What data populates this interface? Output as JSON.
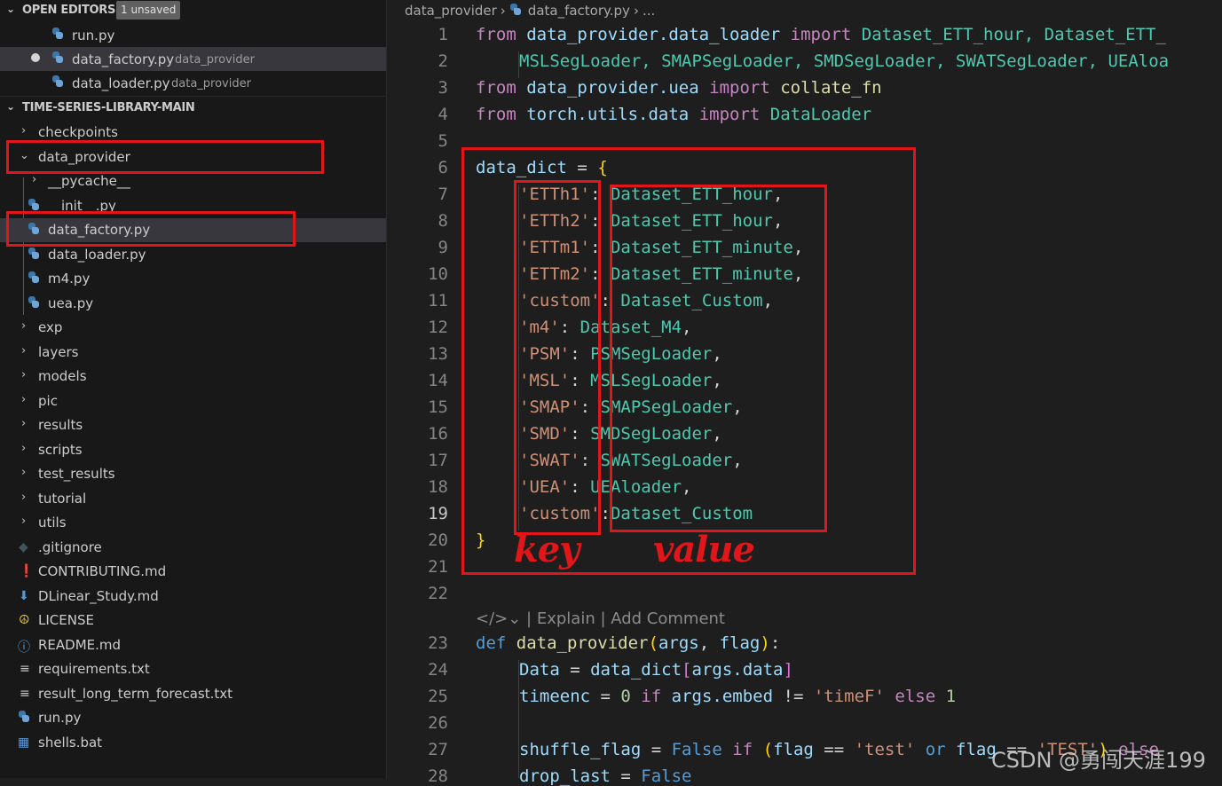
{
  "sidebar": {
    "open_editors": {
      "title": "OPEN EDITORS",
      "badge": "1 unsaved",
      "items": [
        {
          "name": "run.py",
          "path": ""
        },
        {
          "name": "data_factory.py",
          "path": "data_provider"
        },
        {
          "name": "data_loader.py",
          "path": "data_provider"
        }
      ]
    },
    "explorer": {
      "title": "TIME-SERIES-LIBRARY-MAIN",
      "items": [
        {
          "label": "checkpoints",
          "kind": "folder"
        },
        {
          "label": "data_provider",
          "kind": "folder-open"
        },
        {
          "label": "__pycache__",
          "kind": "folder"
        },
        {
          "label": "__init__.py",
          "kind": "py"
        },
        {
          "label": "data_factory.py",
          "kind": "py"
        },
        {
          "label": "data_loader.py",
          "kind": "py"
        },
        {
          "label": "m4.py",
          "kind": "py"
        },
        {
          "label": "uea.py",
          "kind": "py"
        },
        {
          "label": "exp",
          "kind": "folder"
        },
        {
          "label": "layers",
          "kind": "folder"
        },
        {
          "label": "models",
          "kind": "folder"
        },
        {
          "label": "pic",
          "kind": "folder"
        },
        {
          "label": "results",
          "kind": "folder"
        },
        {
          "label": "scripts",
          "kind": "folder"
        },
        {
          "label": "test_results",
          "kind": "folder"
        },
        {
          "label": "tutorial",
          "kind": "folder"
        },
        {
          "label": "utils",
          "kind": "folder"
        },
        {
          "label": ".gitignore",
          "kind": "git"
        },
        {
          "label": "CONTRIBUTING.md",
          "kind": "md-red"
        },
        {
          "label": "DLinear_Study.md",
          "kind": "md-blue"
        },
        {
          "label": "LICENSE",
          "kind": "license"
        },
        {
          "label": "README.md",
          "kind": "info"
        },
        {
          "label": "requirements.txt",
          "kind": "txt"
        },
        {
          "label": "result_long_term_forecast.txt",
          "kind": "txt"
        },
        {
          "label": "run.py",
          "kind": "py"
        },
        {
          "label": "shells.bat",
          "kind": "bat"
        }
      ]
    }
  },
  "editor": {
    "breadcrumb": [
      "data_provider",
      "data_factory.py",
      "..."
    ],
    "codelens": "| Explain | Add Comment",
    "current_line": "19",
    "line_numbers": [
      "1",
      "2",
      "3",
      "4",
      "5",
      "6",
      "7",
      "8",
      "9",
      "10",
      "11",
      "12",
      "13",
      "14",
      "15",
      "16",
      "17",
      "18",
      "19",
      "20",
      "21",
      "22",
      "23",
      "24",
      "25",
      "26",
      "27",
      "28"
    ],
    "code": {
      "l1": [
        "from",
        "data_provider.data_loader",
        "import",
        "Dataset_ETT_hour,",
        "Dataset_ETT_"
      ],
      "l2": "MSLSegLoader, SMAPSegLoader, SMDSegLoader, SWATSegLoader, UEAloa",
      "l3": [
        "from",
        "data_provider.uea",
        "import",
        "collate_fn"
      ],
      "l4": [
        "from",
        "torch.utils.data",
        "import",
        "DataLoader"
      ],
      "l6": [
        "data_dict",
        "=",
        "{"
      ],
      "dict_entries": [
        {
          "key": "'ETTh1'",
          "value": "Dataset_ETT_hour"
        },
        {
          "key": "'ETTh2'",
          "value": "Dataset_ETT_hour"
        },
        {
          "key": "'ETTm1'",
          "value": "Dataset_ETT_minute"
        },
        {
          "key": "'ETTm2'",
          "value": "Dataset_ETT_minute"
        },
        {
          "key": "'custom'",
          "value": "Dataset_Custom"
        },
        {
          "key": "'m4'",
          "value": "Dataset_M4"
        },
        {
          "key": "'PSM'",
          "value": "PSMSegLoader"
        },
        {
          "key": "'MSL'",
          "value": "MSLSegLoader"
        },
        {
          "key": "'SMAP'",
          "value": "SMAPSegLoader"
        },
        {
          "key": "'SMD'",
          "value": "SMDSegLoader"
        },
        {
          "key": "'SWAT'",
          "value": "SWATSegLoader"
        },
        {
          "key": "'UEA'",
          "value": "UEAloader"
        },
        {
          "key": "'custom'",
          "value": "Dataset_Custom"
        }
      ],
      "l20": "}",
      "l23": [
        "def",
        "data_provider",
        "args",
        "flag"
      ],
      "l24": [
        "Data",
        "data_dict",
        "args.data"
      ],
      "l25": [
        "timeenc",
        "0",
        "if",
        "args.embed",
        "!=",
        "'timeF'",
        "else",
        "1"
      ],
      "l27": [
        "shuffle_flag",
        "False",
        "if",
        "flag",
        "'test'",
        "or",
        "flag",
        "==",
        "'TEST'",
        "else"
      ],
      "l28": [
        "drop_last",
        "False"
      ]
    }
  },
  "annotations": {
    "key_label": "key",
    "value_label": "value",
    "color": "#e0161a"
  },
  "watermark": "CSDN @勇闯天涯199"
}
